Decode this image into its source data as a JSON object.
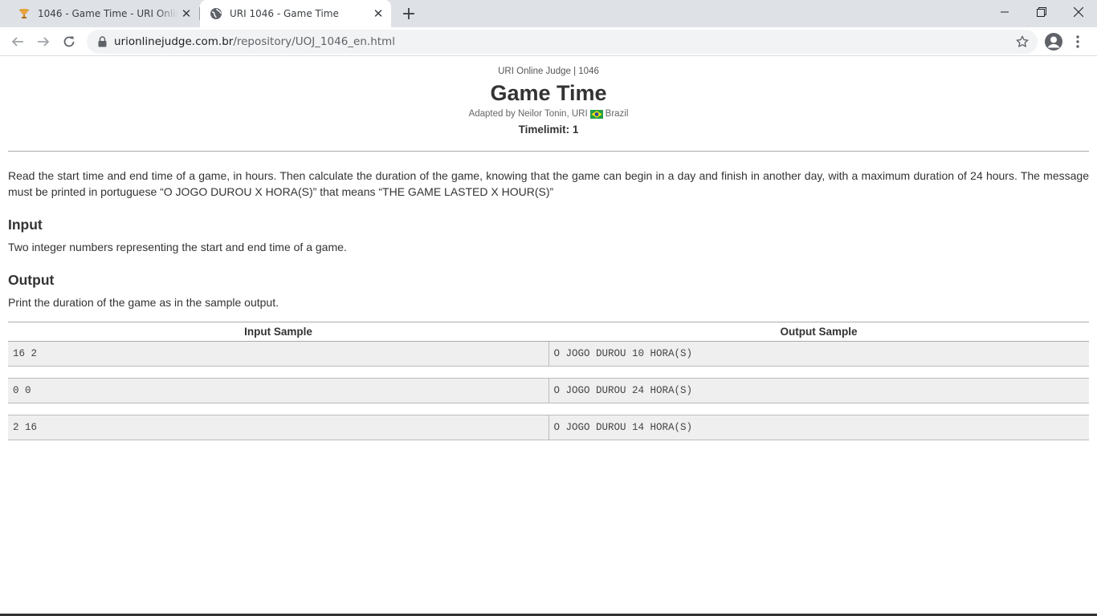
{
  "browser": {
    "tabs": [
      {
        "title": "1046 - Game Time - URI Online Judge",
        "favicon": "trophy-icon",
        "active": false
      },
      {
        "title": "URI 1046 - Game Time",
        "favicon": "globe-icon",
        "active": true
      }
    ],
    "url_host": "urionlinejudge.com.br",
    "url_path": "/repository/UOJ_1046_en.html"
  },
  "problem": {
    "judge_line": "URI Online Judge | 1046",
    "title": "Game Time",
    "author_prefix": "Adapted by Neilor Tonin, URI",
    "author_country": "Brazil",
    "timelimit": "Timelimit: 1",
    "description": "Read the start time and end time of a game, in hours. Then calculate the duration of the game, knowing that the game can begin in a day and finish in another day, with a maximum duration of 24 hours. The message must be printed in portuguese “O JOGO DUROU X HORA(S)” that means “THE GAME LASTED X HOUR(S)”",
    "input_heading": "Input",
    "input_text": "Two integer numbers representing the start and end time of a game.",
    "output_heading": "Output",
    "output_text": "Print the duration of the game as in the sample output."
  },
  "samples": {
    "input_header": "Input Sample",
    "output_header": "Output Sample",
    "rows": [
      {
        "input": "16 2",
        "output": "O JOGO DUROU 10 HORA(S)"
      },
      {
        "input": "0 0",
        "output": "O JOGO DUROU 24 HORA(S)"
      },
      {
        "input": "2 16",
        "output": "O JOGO DUROU 14 HORA(S)"
      }
    ]
  }
}
